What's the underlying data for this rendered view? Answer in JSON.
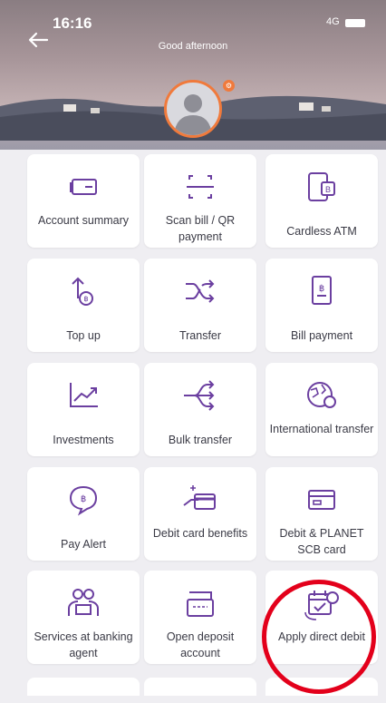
{
  "status": {
    "time": "16:16",
    "network": "4G"
  },
  "header": {
    "greeting": "Good afternoon"
  },
  "tiles": [
    {
      "label": "Account summary",
      "icon": "account-summary-icon"
    },
    {
      "label": "Scan bill / QR payment",
      "icon": "scan-qr-icon"
    },
    {
      "label": "Cardless ATM",
      "icon": "cardless-atm-icon"
    },
    {
      "label": "Top up",
      "icon": "top-up-icon"
    },
    {
      "label": "Transfer",
      "icon": "transfer-icon"
    },
    {
      "label": "Bill payment",
      "icon": "bill-payment-icon"
    },
    {
      "label": "Investments",
      "icon": "investments-icon"
    },
    {
      "label": "Bulk transfer",
      "icon": "bulk-transfer-icon"
    },
    {
      "label": "International transfer",
      "icon": "international-transfer-icon"
    },
    {
      "label": "Pay Alert",
      "icon": "pay-alert-icon"
    },
    {
      "label": "Debit card benefits",
      "icon": "debit-card-benefits-icon"
    },
    {
      "label": "Debit & PLANET SCB card",
      "icon": "debit-planet-card-icon"
    },
    {
      "label": "Services at banking agent",
      "icon": "banking-agent-icon"
    },
    {
      "label": "Open deposit account",
      "icon": "open-deposit-icon"
    },
    {
      "label": "Apply direct debit",
      "icon": "direct-debit-icon"
    }
  ],
  "colors": {
    "accent": "#6b3fa0",
    "highlight": "#e3001b",
    "avatar_ring": "#f07a3c"
  }
}
